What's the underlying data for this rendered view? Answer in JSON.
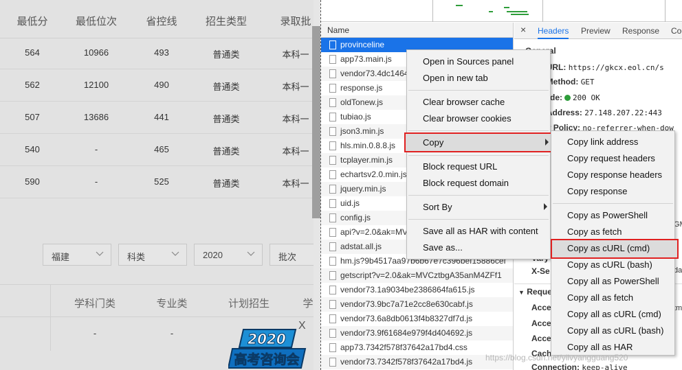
{
  "webpage": {
    "table_headers": [
      "最低分",
      "最低位次",
      "省控线",
      "招生类型",
      "录取批"
    ],
    "rows": [
      [
        "564",
        "10966",
        "493",
        "普通类",
        "本科一"
      ],
      [
        "562",
        "12100",
        "490",
        "普通类",
        "本科一"
      ],
      [
        "507",
        "13686",
        "441",
        "普通类",
        "本科一"
      ],
      [
        "540",
        "-",
        "465",
        "普通类",
        "本科一"
      ],
      [
        "590",
        "-",
        "525",
        "普通类",
        "本科一"
      ]
    ],
    "filters": [
      "福建",
      "科类",
      "2020",
      "批次"
    ],
    "table2_headers": [
      "学科门类",
      "专业类",
      "计划招生",
      "学"
    ],
    "table2_row": [
      "-",
      "-",
      "-"
    ],
    "ad_close": "X",
    "ad_text_year": "2020",
    "ad_text_title": "高考咨询会"
  },
  "devtools": {
    "name_header": "Name",
    "requests": [
      "provinceline",
      "app73.main.js",
      "vendor73.4dc1464",
      "response.js",
      "oldTonew.js",
      "tubiao.js",
      "json3.min.js",
      "hls.min.0.8.8.js",
      "tcplayer.min.js",
      "echartsv2.0.min.js",
      "jquery.min.js",
      "uid.js",
      "config.js",
      "api?v=2.0&ak=MV",
      "adstat.all.js",
      "hm.js?9b4517aa97b6b67e7c396bef15886cef",
      "getscript?v=2.0&ak=MVCztbgA35anM4ZFf1",
      "vendor73.1a9034be2386864fa615.js",
      "vendor73.9bc7a71e2cc8e630cabf.js",
      "vendor73.6a8db0613f4b8327df7d.js",
      "vendor73.9f61684e979f4d404692.js",
      "app73.7342f578f37642a17bd4.css",
      "vendor73.7342f578f37642a17bd4.js"
    ],
    "close_x": "×",
    "tabs": [
      "Headers",
      "Preview",
      "Response",
      "Coo"
    ],
    "general": {
      "section": "General",
      "request_url_label": "est URL:",
      "request_url": "https://gkcx.eol.cn/s",
      "method_label": "est Method:",
      "method": "GET",
      "status_label": "s Code:",
      "status": "200 OK",
      "remote_label": "ote Address:",
      "remote": "27.148.207.22:443",
      "referrer_label": "errer Policy:",
      "referrer": "no-referrer-when-dow"
    },
    "partial_labels": [
      "Vary",
      "X-Se",
      "Reque",
      "Acce",
      "Acce",
      "Acce",
      "Cach"
    ],
    "partial_gm": "GM",
    "partial_da": "da",
    "partial_ak": "tm",
    "connection_label": "Connection:",
    "connection": "keep-alive"
  },
  "menu1": {
    "items": [
      "Open in Sources panel",
      "Open in new tab",
      "Clear browser cache",
      "Clear browser cookies",
      "Copy",
      "Block request URL",
      "Block request domain",
      "Sort By",
      "Save all as HAR with content",
      "Save as..."
    ]
  },
  "menu2": {
    "items": [
      "Copy link address",
      "Copy request headers",
      "Copy response headers",
      "Copy response",
      "Copy as PowerShell",
      "Copy as fetch",
      "Copy as cURL (cmd)",
      "Copy as cURL (bash)",
      "Copy all as PowerShell",
      "Copy all as fetch",
      "Copy all as cURL (cmd)",
      "Copy all as cURL (bash)",
      "Copy all as HAR"
    ]
  },
  "watermark": "https://blog.csdn.net/yilvyangguang520",
  "colors": {
    "accent": "#1a73e8",
    "highlight_box": "#e02020",
    "status_green": "#2e9d3a"
  }
}
